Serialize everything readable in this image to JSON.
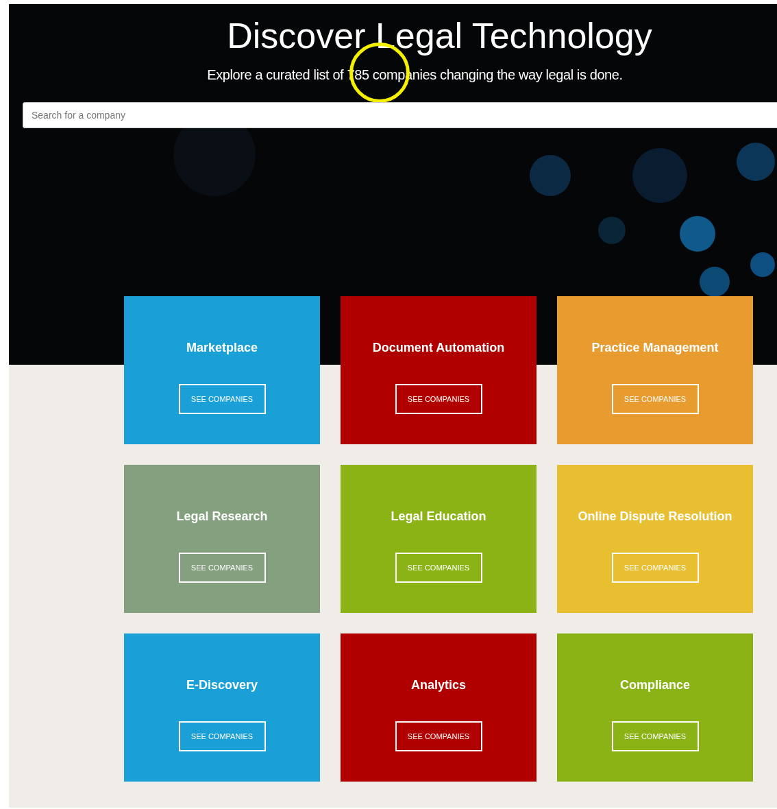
{
  "hero": {
    "title": "Discover Legal Technology",
    "subtitle": "Explore a curated list of 785 companies changing the way legal is done.",
    "search": {
      "placeholder": "Search for a company"
    },
    "highlight": true
  },
  "categories": [
    {
      "title": "Marketplace",
      "button": "SEE COMPANIES",
      "color": "#1aa0d6"
    },
    {
      "title": "Document Automation",
      "button": "SEE COMPANIES",
      "color": "#b00000"
    },
    {
      "title": "Practice Management",
      "button": "SEE COMPANIES",
      "color": "#e89c30"
    },
    {
      "title": "Legal Research",
      "button": "SEE COMPANIES",
      "color": "#84a07e"
    },
    {
      "title": "Legal Education",
      "button": "SEE COMPANIES",
      "color": "#8bb316"
    },
    {
      "title": "Online Dispute Resolution",
      "button": "SEE COMPANIES",
      "color": "#e8bf30"
    },
    {
      "title": "E-Discovery",
      "button": "SEE COMPANIES",
      "color": "#1aa0d6"
    },
    {
      "title": "Analytics",
      "button": "SEE COMPANIES",
      "color": "#b00000"
    },
    {
      "title": "Compliance",
      "button": "SEE COMPANIES",
      "color": "#8bb316"
    }
  ]
}
